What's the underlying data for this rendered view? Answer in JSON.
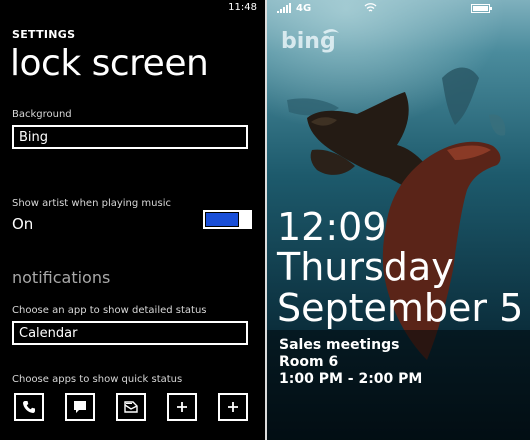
{
  "settings": {
    "status_time": "11:48",
    "crumb": "SETTINGS",
    "title": "lock screen",
    "background_label": "Background",
    "background_value": "Bing",
    "show_artist_label": "Show artist when playing music",
    "show_artist_value": "On",
    "show_artist_enabled": true,
    "notifications_header": "notifications",
    "detailed_status_label": "Choose an app to show detailed status",
    "detailed_status_value": "Calendar",
    "quick_status_label": "Choose apps to show quick status",
    "quick_status_slots": [
      "phone-icon",
      "message-icon",
      "email-icon",
      "add-icon",
      "add-icon"
    ],
    "accent_color": "#1a4fd8"
  },
  "lockscreen": {
    "network": "4G",
    "logo_text": "bing",
    "time": "12:09",
    "day": "Thursday",
    "date": "September 5",
    "event_title": "Sales meetings",
    "event_location": "Room 6",
    "event_time": "1:00 PM - 2:00 PM"
  }
}
